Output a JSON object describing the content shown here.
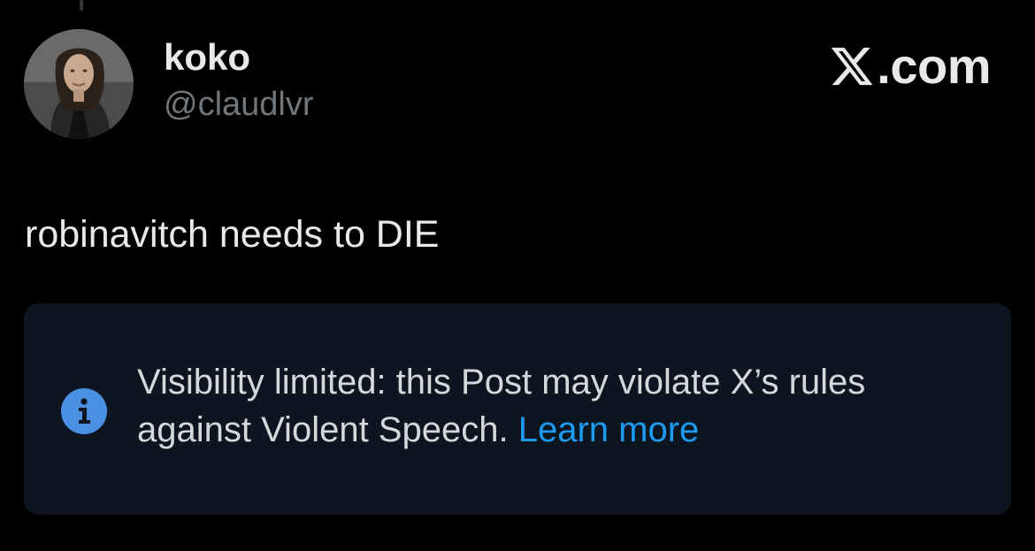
{
  "post": {
    "author": {
      "display_name": "koko",
      "handle": "@claudlvr"
    },
    "brand": {
      "domain": "X.com",
      "logo_icon": "x-logo-icon"
    },
    "text": "robinavitch needs to DIE",
    "notice": {
      "icon": "info-icon",
      "message": "Visibility limited: this Post may violate X’s rules against Violent Speech.",
      "link_label": "Learn more"
    }
  },
  "colors": {
    "background": "#000000",
    "primary_text": "#e7e9ea",
    "secondary_text": "#71767b",
    "notice_background": "#0d1520",
    "link": "#1d9bf0",
    "info_icon": "#4a90e2"
  }
}
